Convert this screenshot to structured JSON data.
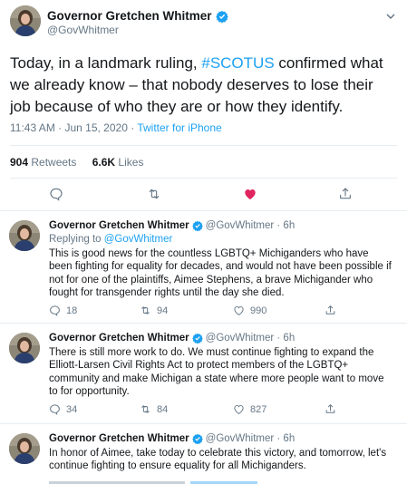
{
  "main": {
    "name": "Governor Gretchen Whitmer",
    "handle": "@GovWhitmer",
    "text_before": "Today, in a landmark ruling, ",
    "hashtag": "#SCOTUS",
    "text_after": " confirmed what we already know – that nobody deserves to lose their job because of who they are or how they identify.",
    "time": "11:43 AM · Jun 15, 2020 · ",
    "source": "Twitter for iPhone",
    "retweets_count": "904",
    "retweets_label": " Retweets",
    "likes_count": "6.6K",
    "likes_label": " Likes",
    "liked": true
  },
  "colors": {
    "accent": "#1da1f2",
    "like": "#e0245e",
    "muted": "#657786",
    "text": "#14171a",
    "divider": "#e6ecf0"
  },
  "icons": [
    "verified-icon",
    "chevron-down-icon",
    "reply-icon",
    "retweet-icon",
    "heart-icon",
    "share-icon"
  ],
  "replies": [
    {
      "name": "Governor Gretchen Whitmer",
      "handle": "@GovWhitmer · 6h",
      "replying_label": "Replying to ",
      "replying_handle": "@GovWhitmer",
      "text": "This is good news for the countless LGBTQ+ Michiganders who have been fighting for equality for decades, and would not have been possible if not for one of the plaintiffs, Aimee Stephens, a brave Michigander who fought for transgender rights until the day she died.",
      "replies": "18",
      "retweets": "94",
      "likes": "990"
    },
    {
      "name": "Governor Gretchen Whitmer",
      "handle": "@GovWhitmer · 6h",
      "text": "There is still more work to do. We must continue fighting to expand the Elliott-Larsen Civil Rights Act to protect members of the LGBTQ+ community and make Michigan a state where more people want to move to for opportunity.",
      "replies": "34",
      "retweets": "84",
      "likes": "827"
    },
    {
      "name": "Governor Gretchen Whitmer",
      "handle": "@GovWhitmer · 6h",
      "text": "In honor of Aimee, take today to celebrate this victory, and tomorrow, let's continue fighting to ensure equality for all Michiganders."
    }
  ]
}
